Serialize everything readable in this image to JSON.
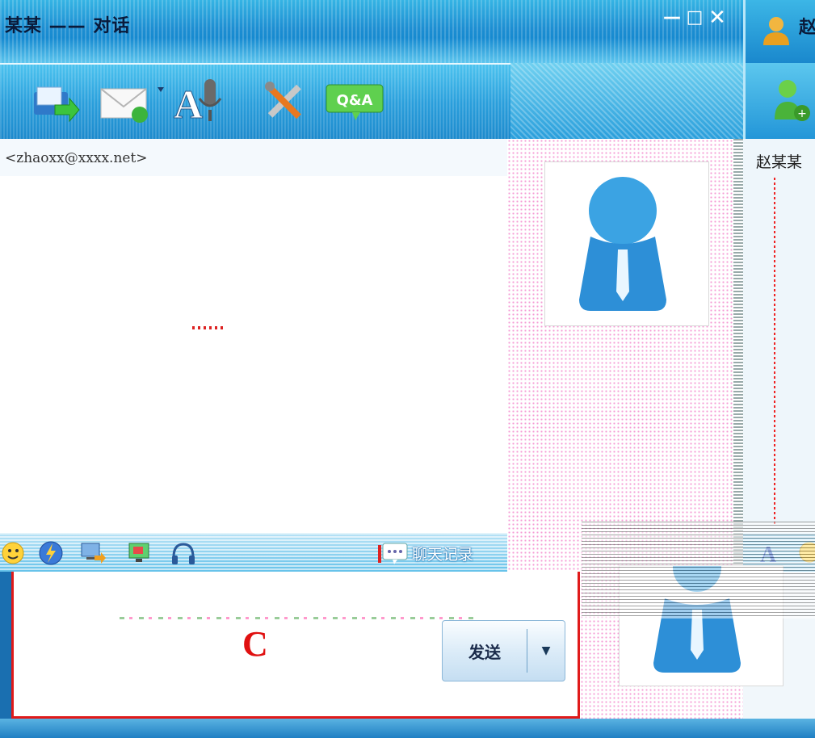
{
  "main_window": {
    "title": "某某 —— 对话",
    "window_controls": {
      "minimize": "—",
      "maximize": "□",
      "close": "✕"
    },
    "toolbar": {
      "tools": [
        {
          "icon": "file-transfer-icon"
        },
        {
          "icon": "mail-icon"
        },
        {
          "icon": "voice-chat-icon"
        },
        {
          "icon": "settings-tools-icon"
        },
        {
          "icon": "qa-icon",
          "label": "Q&A"
        }
      ]
    },
    "contact_email": "<zhaoxx@xxxx.net>",
    "input_toolbar": {
      "tools": [
        "emoticon-icon",
        "shake-icon",
        "screen-share-icon",
        "screenshot-icon",
        "music-icon"
      ],
      "chat_history_label": "聊天记录"
    },
    "input_area_label": "C",
    "send_button_label": "发送",
    "colors": {
      "title_bar": "#1d8ed2",
      "input_border": "#e01a1a",
      "label_c": "#e01010",
      "side_panel_dots": "#f59cd5"
    }
  },
  "back_window": {
    "title": "赵",
    "contact_name": "赵某某"
  }
}
